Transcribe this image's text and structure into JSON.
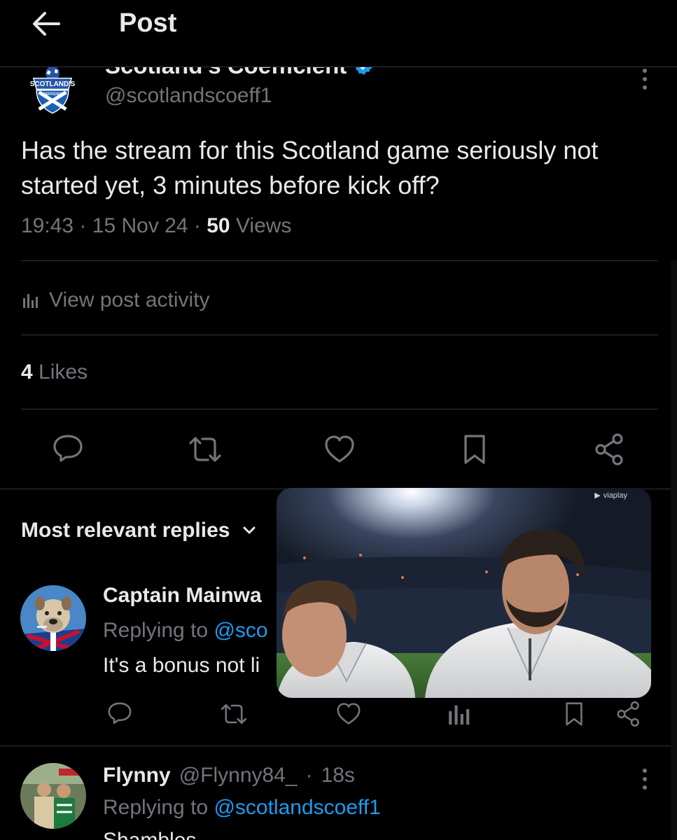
{
  "header": {
    "title": "Post"
  },
  "post": {
    "author_name": "Scotland's Coefficient",
    "author_handle": "@scotlandscoeff1",
    "avatar_text": "SCOTLAND'S",
    "avatar_subtext": "COEFFICIENT",
    "text": "Has the stream for this Scotland game seriously not started yet, 3 minutes before kick off?",
    "time": "19:43",
    "separator": "·",
    "date": "15 Nov 24",
    "views_count": "50",
    "views_label": "Views",
    "activity_label": "View post activity",
    "likes_count": "4",
    "likes_label": "Likes"
  },
  "replies_header": {
    "label": "Most relevant replies"
  },
  "replies": [
    {
      "name": "Captain Mainwa",
      "replying_prefix": "Replying to",
      "replying_to": "@sco",
      "text": "It's a bonus not li"
    },
    {
      "name": "Flynny",
      "handle": "@Flynny84_",
      "separator": "·",
      "time": "18s",
      "replying_prefix": "Replying to",
      "replying_to": "@scotlandscoeff1",
      "text": "Shambles"
    }
  ],
  "video": {
    "brand": "viaplay"
  },
  "colors": {
    "background": "#000000",
    "text": "#e7e9ea",
    "muted": "#71767b",
    "link": "#1d9bf0",
    "divider": "#2f3336",
    "verified": "#1d9bf0"
  }
}
